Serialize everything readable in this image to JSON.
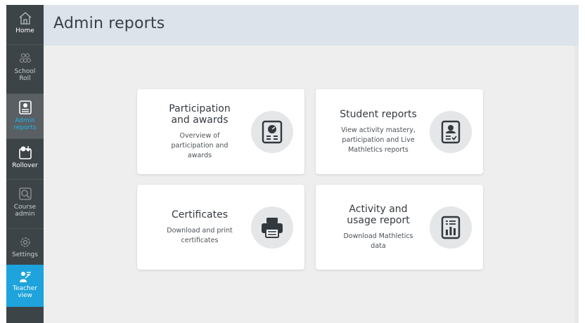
{
  "header": {
    "title": "Admin reports"
  },
  "sidebar": {
    "items": [
      {
        "label": "Home",
        "icon": "home-icon"
      },
      {
        "label": "School Roll",
        "icon": "people-icon"
      },
      {
        "label": "Admin reports",
        "icon": "report-icon"
      },
      {
        "label": "Rollover",
        "icon": "rollover-icon"
      },
      {
        "label": "Course admin",
        "icon": "course-icon"
      },
      {
        "label": "Settings",
        "icon": "gear-icon"
      },
      {
        "label": "Teacher view",
        "icon": "teacher-icon"
      }
    ]
  },
  "cards": [
    {
      "title": "Participation and awards",
      "description": "Overview of participation and awards",
      "icon": "presentation-icon"
    },
    {
      "title": "Student reports",
      "description": "View activity mastery, participation and Live Mathletics reports",
      "icon": "student-report-icon"
    },
    {
      "title": "Certificates",
      "description": "Download and print certificates",
      "icon": "printer-icon"
    },
    {
      "title": "Activity and usage report",
      "description": "Download Mathletics data",
      "icon": "bar-chart-report-icon"
    }
  ],
  "colors": {
    "sidebar": "#3d4448",
    "active_text": "#20b6e8",
    "teacher_bg": "#1ea3dc",
    "header_bg": "#dde3ea",
    "content_bg": "#eeeeee"
  }
}
